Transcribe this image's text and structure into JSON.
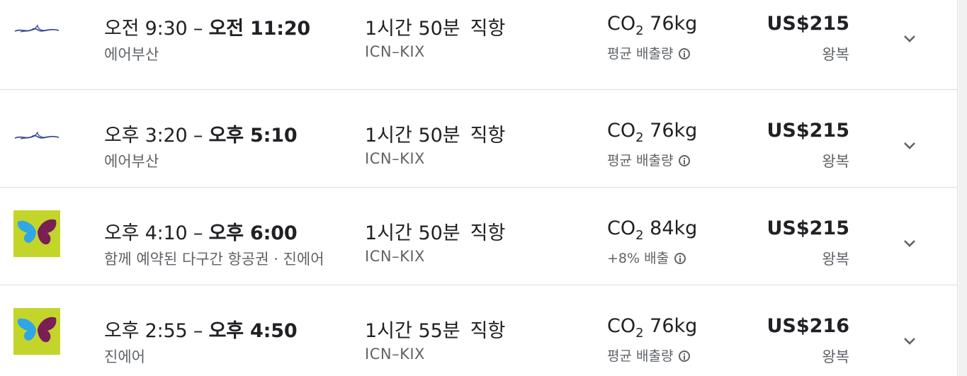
{
  "flights": [
    {
      "logo": "air-busan-logo",
      "depart": "오전 9:30",
      "arrive": "오전 11:20",
      "airline": "에어부산",
      "duration": "1시간 50분",
      "stops": "직항",
      "route": "ICN–KIX",
      "co2_value": "76kg",
      "emissions": "평균 배출량",
      "price": "US$215",
      "price_type": "왕복"
    },
    {
      "logo": "air-busan-logo",
      "depart": "오후 3:20",
      "arrive": "오후 5:10",
      "airline": "에어부산",
      "duration": "1시간 50분",
      "stops": "직항",
      "route": "ICN–KIX",
      "co2_value": "76kg",
      "emissions": "평균 배출량",
      "price": "US$215",
      "price_type": "왕복"
    },
    {
      "logo": "jin-air-logo",
      "depart": "오후 4:10",
      "arrive": "오후 6:00",
      "airline": "함께 예약된 다구간 항공권 · 진에어",
      "duration": "1시간 50분",
      "stops": "직항",
      "route": "ICN–KIX",
      "co2_value": "84kg",
      "emissions": "+8% 배출",
      "price": "US$215",
      "price_type": "왕복"
    },
    {
      "logo": "jin-air-logo",
      "depart": "오후 2:55",
      "arrive": "오후 4:50",
      "airline": "진에어",
      "duration": "1시간 55분",
      "stops": "직항",
      "route": "ICN–KIX",
      "co2_value": "76kg",
      "emissions": "평균 배출량",
      "price": "US$216",
      "price_type": "왕복"
    }
  ],
  "co2_label": "CO",
  "co2_sub": "2",
  "time_separator": " – ",
  "colors": {
    "text": "#202124",
    "secondary": "#5f6368",
    "divider": "#dadce0",
    "jin_air_bg": "#c3d52b",
    "jin_air_blue": "#2fa6e6",
    "jin_air_purple": "#7a1e56",
    "air_busan_blue": "#2b3f8f"
  }
}
